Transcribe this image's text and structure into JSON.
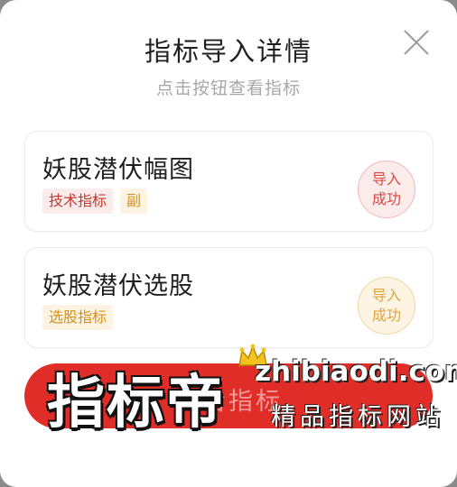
{
  "dialog": {
    "title": "指标导入详情",
    "subtitle": "点击按钮查看指标"
  },
  "cards": [
    {
      "name": "妖股潜伏幅图",
      "tags": [
        "技术指标",
        "副"
      ],
      "status": "导入\n成功",
      "status_color": "#d94a45"
    },
    {
      "name": "妖股潜伏选股",
      "tags": [
        "选股指标"
      ],
      "status": "导入\n成功",
      "status_color": "#e0a43a"
    }
  ],
  "primary_button": {
    "label": "查看指标"
  },
  "watermark": {
    "brand": "指标帝",
    "url": "zhibiaodi.com",
    "tagline": "精品指标网站"
  },
  "colors": {
    "accent": "#e02d28",
    "tag_red": "#c8362f",
    "tag_orange": "#d89018"
  }
}
